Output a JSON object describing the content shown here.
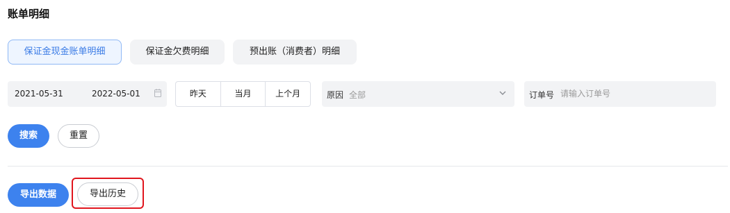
{
  "page": {
    "title": "账单明细"
  },
  "tabs": [
    {
      "label": "保证金现金账单明细",
      "active": true
    },
    {
      "label": "保证金欠费明细",
      "active": false
    },
    {
      "label": "预出账（消费者）明细",
      "active": false
    }
  ],
  "filters": {
    "date_start": "2021-05-31",
    "date_end": "2022-05-01",
    "calendar_icon": "calendar-icon",
    "quick_ranges": [
      "昨天",
      "当月",
      "上个月"
    ],
    "reason": {
      "label": "原因",
      "value": "全部",
      "icon": "chevron-down-icon"
    },
    "order": {
      "label": "订单号",
      "placeholder": "请输入订单号",
      "value": ""
    }
  },
  "actions": {
    "search_label": "搜索",
    "reset_label": "重置"
  },
  "export": {
    "export_label": "导出数据",
    "history_label": "导出历史"
  },
  "colors": {
    "primary": "#3d82ee",
    "active_tab_text": "#3a7be6",
    "highlight": "#e0151d"
  }
}
